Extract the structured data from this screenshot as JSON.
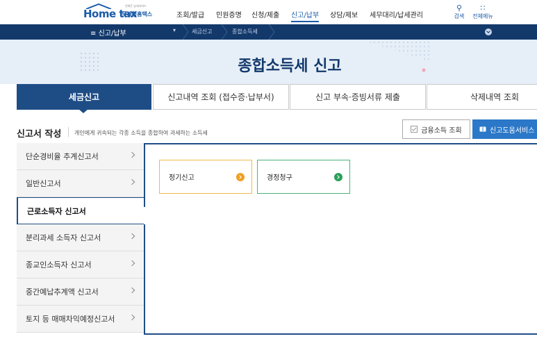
{
  "header": {
    "logo_text": "Home tax",
    "logo_subtitle": "국세청홈택스",
    "logo_tagline": "언제든 납세서비스",
    "menu": [
      "조회/발급",
      "민원증명",
      "신청/제출",
      "신고/납부",
      "상담/제보",
      "세무대리/납세관리"
    ],
    "active_menu": "신고/납부",
    "search_label": "검색",
    "all_menu_label": "전체메뉴"
  },
  "breadcrumb": {
    "current": "신고/납부",
    "crumbs": [
      "세금신고",
      "종합소득세"
    ]
  },
  "page": {
    "title": "종합소득세 신고"
  },
  "tabs": [
    {
      "label": "세금신고",
      "active": true
    },
    {
      "label": "신고내역 조회 (접수증·납부서)",
      "active": false
    },
    {
      "label": "신고 부속·증빙서류 제출",
      "active": false
    },
    {
      "label": "삭제내역 조회",
      "active": false
    }
  ],
  "section": {
    "title": "신고서 작성",
    "description": "개인에게 귀속되는 각종 소득을 종합하여 과세하는 소득세",
    "btn_financial": "금융소득 조회",
    "btn_help": "신고도움서비스"
  },
  "sidebar": {
    "items": [
      {
        "label": "단순경비율 추계신고서",
        "active": false
      },
      {
        "label": "일반신고서",
        "active": false
      },
      {
        "label": "근로소득자 신고서",
        "active": true
      },
      {
        "label": "분리과세 소득자 신고서",
        "active": false
      },
      {
        "label": "종교인소득자 신고서",
        "active": false
      },
      {
        "label": "중간예납추계액 신고서",
        "active": false
      },
      {
        "label": "토지 등 매매차익예정신고서",
        "active": false
      }
    ]
  },
  "cards": [
    {
      "label": "정기신고",
      "color": "#f0a020"
    },
    {
      "label": "경정청구",
      "color": "#2aa05a"
    }
  ],
  "colors": {
    "brand": "#1b5ba8",
    "navy": "#13396b",
    "tab_active": "#1e4d86",
    "help_button": "#2b78c8"
  }
}
